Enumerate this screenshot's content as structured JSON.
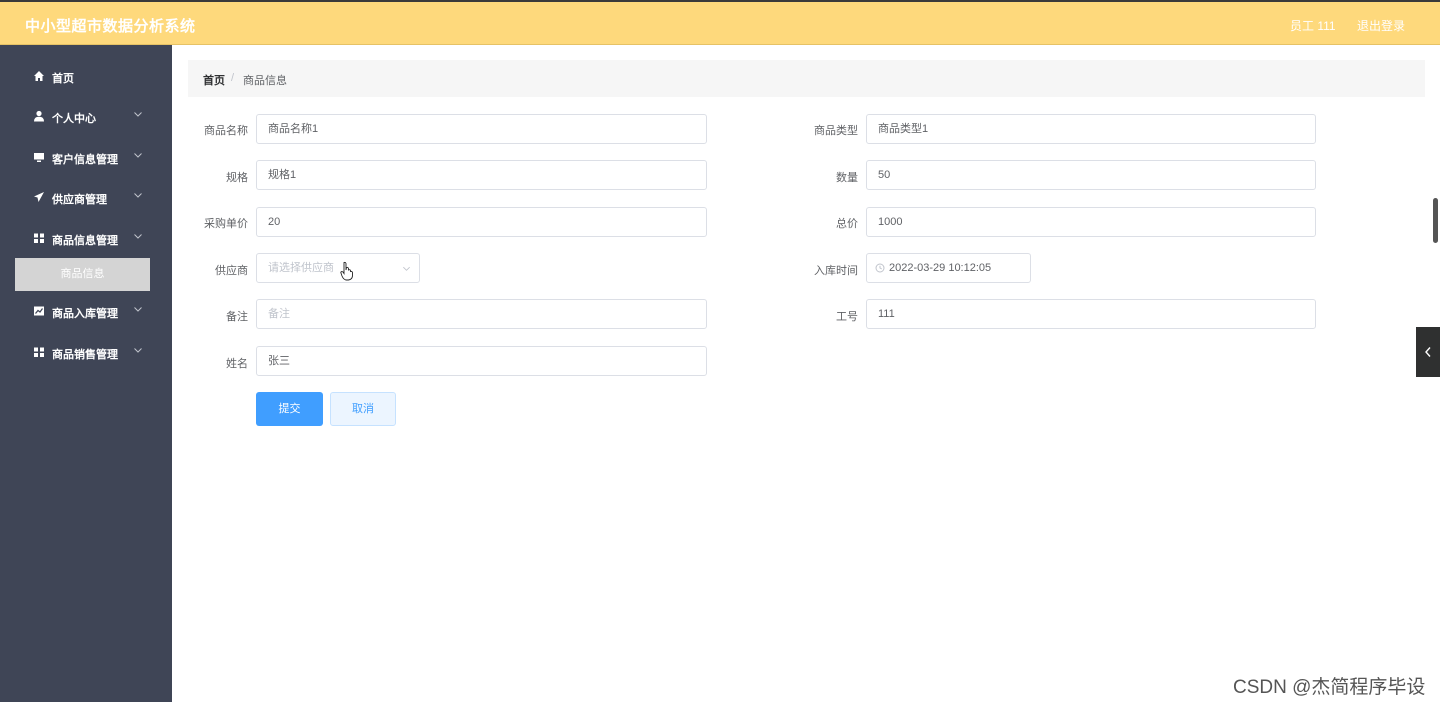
{
  "header": {
    "title": "中小型超市数据分析系统",
    "user": "员工 111",
    "logout": "退出登录",
    "bg_color": "#fed97c"
  },
  "sidebar": {
    "bg_color": "#3f4556",
    "items": [
      {
        "label": "首页",
        "icon": "home-icon"
      },
      {
        "label": "个人中心",
        "icon": "user-icon"
      },
      {
        "label": "客户信息管理",
        "icon": "monitor-icon"
      },
      {
        "label": "供应商管理",
        "icon": "send-icon"
      },
      {
        "label": "商品信息管理",
        "icon": "grid-icon"
      },
      {
        "label": "商品入库管理",
        "icon": "chart-icon"
      },
      {
        "label": "商品销售管理",
        "icon": "grid-icon"
      }
    ],
    "active_sub": "商品信息"
  },
  "breadcrumb": {
    "home": "首页",
    "separator": "/",
    "current": "商品信息"
  },
  "form": {
    "product_name": {
      "label": "商品名称",
      "value": "商品名称1"
    },
    "product_type": {
      "label": "商品类型",
      "value": "商品类型1"
    },
    "spec": {
      "label": "规格",
      "value": "规格1"
    },
    "quantity": {
      "label": "数量",
      "value": "50"
    },
    "unit_price": {
      "label": "采购单价",
      "value": "20"
    },
    "total_price": {
      "label": "总价",
      "value": "1000"
    },
    "supplier": {
      "label": "供应商",
      "placeholder": "请选择供应商"
    },
    "stock_time": {
      "label": "入库时间",
      "value": "2022-03-29 10:12:05"
    },
    "remark": {
      "label": "备注",
      "placeholder": "备注"
    },
    "employee_no": {
      "label": "工号",
      "value": "111"
    },
    "name": {
      "label": "姓名",
      "value": "张三"
    },
    "submit": "提交",
    "cancel": "取消",
    "accent_color": "#409eff"
  },
  "watermark": "CSDN @杰简程序毕设"
}
